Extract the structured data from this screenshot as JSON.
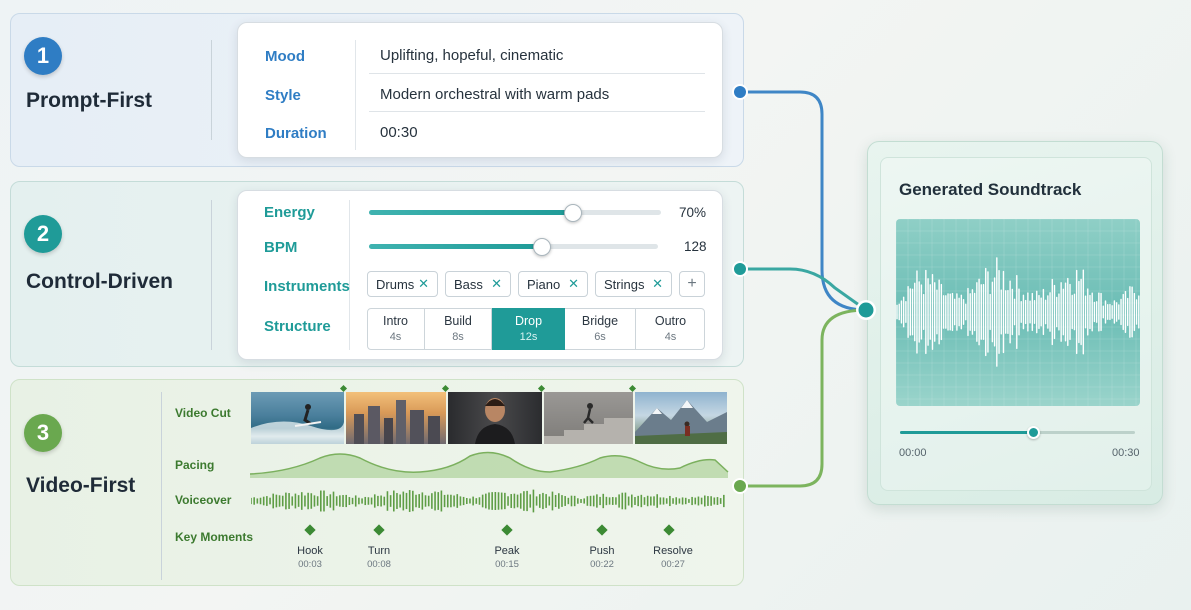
{
  "workflows": [
    {
      "number": "1",
      "title": "Prompt-First",
      "color": "#2f7dc4"
    },
    {
      "number": "2",
      "title": "Control-Driven",
      "color": "#1f9b98"
    },
    {
      "number": "3",
      "title": "Video-First",
      "color": "#6aa84f"
    }
  ],
  "prompt": {
    "label_color": "#2f7dc4",
    "fields": [
      {
        "label": "Mood",
        "value": "Uplifting, hopeful, cinematic"
      },
      {
        "label": "Style",
        "value": "Modern orchestral with warm pads"
      },
      {
        "label": "Duration",
        "value": "00:30"
      }
    ]
  },
  "controls": {
    "label_color": "#1f9b98",
    "energy": {
      "label": "Energy",
      "value_text": "70%",
      "level": 0.7
    },
    "bpm": {
      "label": "BPM",
      "value_text": "128",
      "level": 0.6
    },
    "instruments_label": "Instruments",
    "instruments": [
      "Drums",
      "Bass",
      "Piano",
      "Strings"
    ],
    "add_icon": "plus-icon",
    "remove_icon": "close-icon",
    "structure_label": "Structure",
    "structure": [
      {
        "name": "Intro",
        "dur": "4s",
        "active": false
      },
      {
        "name": "Build",
        "dur": "8s",
        "active": false
      },
      {
        "name": "Drop",
        "dur": "12s",
        "active": true
      },
      {
        "name": "Bridge",
        "dur": "6s",
        "active": false
      },
      {
        "name": "Outro",
        "dur": "4s",
        "active": false
      }
    ]
  },
  "video": {
    "labels": {
      "cut": "Video Cut",
      "pacing": "Pacing",
      "voiceover": "Voiceover",
      "moments": "Key Moments"
    },
    "thumbnails": [
      "surfer-image",
      "city-skyline-image",
      "athlete-portrait-image",
      "runner-stairs-image",
      "mountain-hiker-image"
    ],
    "key_moments": [
      {
        "name": "Hook",
        "time": "00:03"
      },
      {
        "name": "Turn",
        "time": "00:08"
      },
      {
        "name": "Peak",
        "time": "00:15"
      },
      {
        "name": "Push",
        "time": "00:22"
      },
      {
        "name": "Resolve",
        "time": "00:27"
      }
    ]
  },
  "output": {
    "title": "Generated Soundtrack",
    "start_time": "00:00",
    "end_time": "00:30",
    "progress": 0.57,
    "accent": "#1f9b98"
  }
}
